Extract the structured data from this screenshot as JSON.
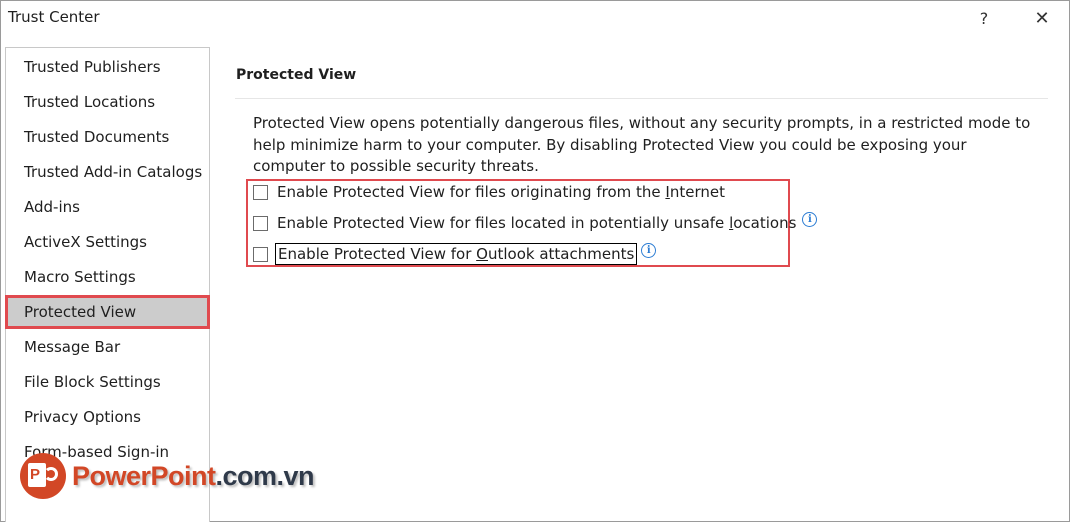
{
  "window": {
    "title": "Trust Center",
    "help_label": "?",
    "close_label": "✕"
  },
  "sidebar": {
    "items": [
      {
        "label": "Trusted Publishers"
      },
      {
        "label": "Trusted Locations"
      },
      {
        "label": "Trusted Documents"
      },
      {
        "label": "Trusted Add-in Catalogs"
      },
      {
        "label": "Add-ins"
      },
      {
        "label": "ActiveX Settings"
      },
      {
        "label": "Macro Settings"
      },
      {
        "label": "Protected View",
        "selected": true
      },
      {
        "label": "Message Bar"
      },
      {
        "label": "File Block Settings"
      },
      {
        "label": "Privacy Options"
      },
      {
        "label": "Form-based Sign-in"
      }
    ]
  },
  "main": {
    "section_title": "Protected View",
    "description": "Protected View opens potentially dangerous files, without any security prompts, in a restricted mode to help minimize harm to your computer. By disabling Protected View you could be exposing your computer to possible security threats.",
    "options": [
      {
        "label_pre": "Enable Protected View for files originating from the ",
        "label_key": "I",
        "label_post": "nternet",
        "checked": false,
        "info": false
      },
      {
        "label_pre": "Enable Protected View for files located in potentially unsafe ",
        "label_key": "l",
        "label_post": "ocations",
        "checked": false,
        "info": true
      },
      {
        "label_pre": "Enable Protected View for ",
        "label_key": "O",
        "label_post": "utlook attachments",
        "checked": false,
        "info": true
      }
    ],
    "info_glyph": "i"
  },
  "watermark": {
    "brand": "PowerPoint",
    "domain": ".com.vn"
  },
  "colors": {
    "highlight_red": "#e04a4f",
    "info_blue": "#2b7cd3",
    "selected_bg": "#cccccc",
    "brand_orange": "#d24726"
  }
}
